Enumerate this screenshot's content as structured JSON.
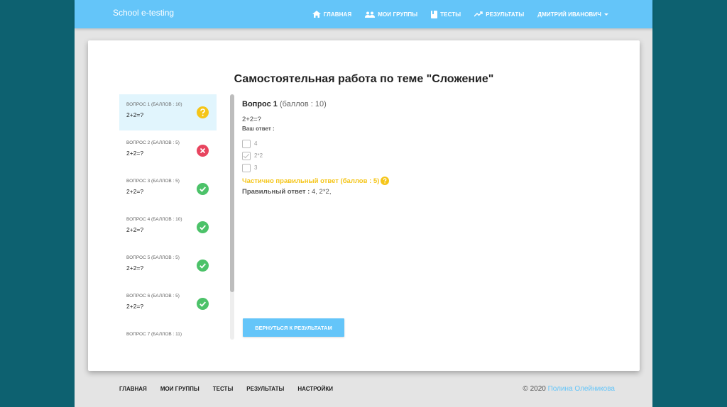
{
  "navbar": {
    "brand": "School e-testing",
    "items": [
      {
        "label": "Главная",
        "icon": "home-icon"
      },
      {
        "label": "Мои группы",
        "icon": "people-icon"
      },
      {
        "label": "Тесты",
        "icon": "book-icon"
      },
      {
        "label": "Результаты",
        "icon": "trending-up-icon"
      }
    ],
    "user": "Дмитрий Иванович"
  },
  "test": {
    "title": "Самостоятельная работа по теме \"Сложение\""
  },
  "questions": [
    {
      "label": "Вопрос 1 (баллов : 10)",
      "text": "2+2=?",
      "status": "partial"
    },
    {
      "label": "Вопрос 2 (баллов : 5)",
      "text": "2+2=?",
      "status": "wrong"
    },
    {
      "label": "Вопрос 3 (баллов : 5)",
      "text": "2+2=?",
      "status": "correct"
    },
    {
      "label": "Вопрос 4 (баллов : 10)",
      "text": "2+2=?",
      "status": "correct"
    },
    {
      "label": "Вопрос 5 (баллов : 5)",
      "text": "2+2=?",
      "status": "correct"
    },
    {
      "label": "Вопрос 6 (баллов : 5)",
      "text": "2+2=?",
      "status": "correct"
    },
    {
      "label": "Вопрос 7 (баллов : 11)",
      "text": "",
      "status": ""
    }
  ],
  "detail": {
    "title": "Вопрос 1",
    "points": "(баллов : 10)",
    "question": "2+2=?",
    "answer_label": "Ваш ответ :",
    "options": [
      {
        "label": "4",
        "checked": false
      },
      {
        "label": "2*2",
        "checked": true
      },
      {
        "label": "3",
        "checked": false
      }
    ],
    "result": "Частично правильный ответ (баллов : 5)",
    "correct_label": "Правильный ответ :",
    "correct_value": "4, 2*2,"
  },
  "back_button": "Вернуться к результатам",
  "footer": {
    "links": [
      "Главная",
      "Мои группы",
      "Тесты",
      "Результаты",
      "Настройки"
    ],
    "copyright": "© 2020",
    "author": "Полина Олейникова"
  },
  "colors": {
    "accent": "#64c5f9",
    "partial": "#f5c518",
    "wrong": "#e8455f",
    "correct": "#4cc269",
    "background": "#0d6170"
  }
}
